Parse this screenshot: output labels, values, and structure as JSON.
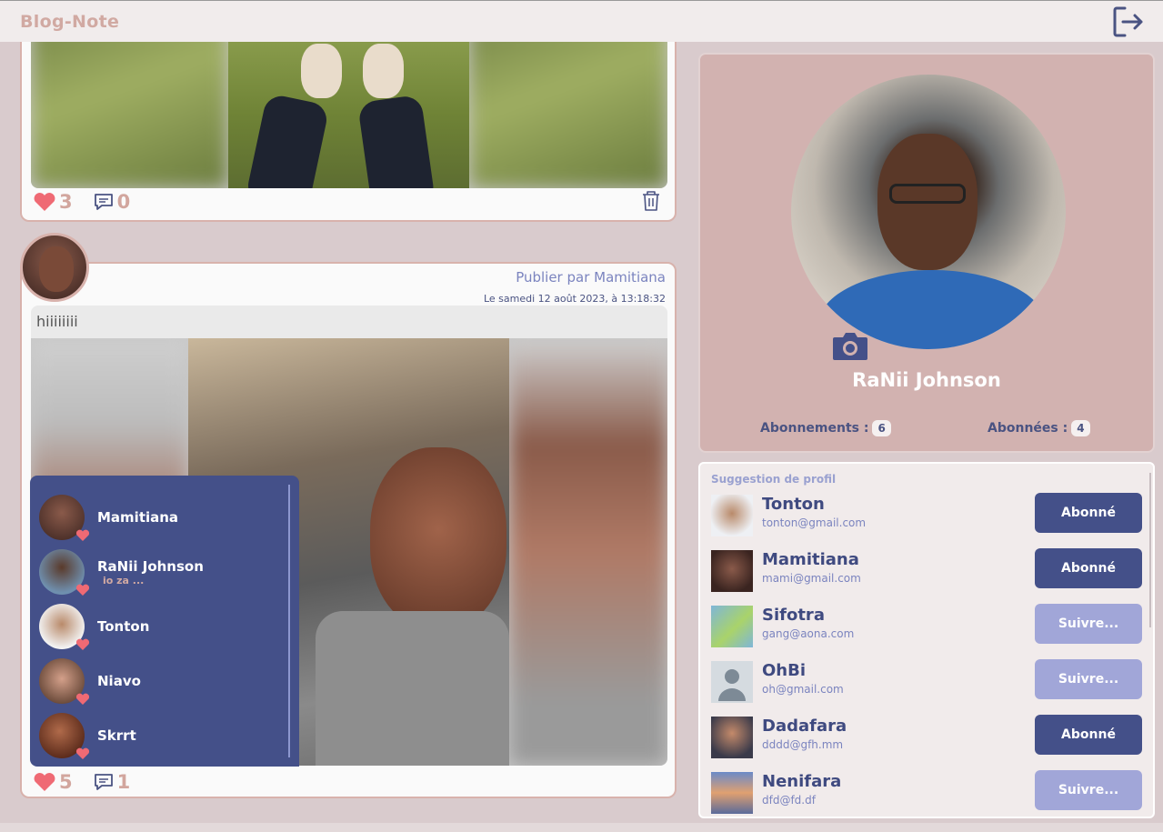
{
  "header": {
    "brand": "Blog-Note"
  },
  "icons": {
    "logout": "logout-icon",
    "heart": "heart-icon",
    "comment": "comment-icon",
    "trash": "trash-icon",
    "camera": "camera-icon"
  },
  "colors": {
    "primary": "#445089",
    "accent": "#d1a9a2",
    "light_button": "#a1a6d8",
    "heart": "#ef6a74"
  },
  "posts": [
    {
      "likes": "3",
      "comments": "0"
    },
    {
      "author": "Publier par Mamitiana",
      "date": "Le samedi 12 août 2023, à 13:18:32",
      "text": "hiiiiiiii",
      "likes": "5",
      "comments": "1"
    }
  ],
  "chat": {
    "items": [
      {
        "name": "Mamitiana",
        "sub": ""
      },
      {
        "name": "RaNii Johnson",
        "sub": "io za ..."
      },
      {
        "name": "Tonton",
        "sub": ""
      },
      {
        "name": "Niavo",
        "sub": ""
      },
      {
        "name": "Skrrt",
        "sub": ""
      }
    ]
  },
  "profile": {
    "name": "RaNii Johnson",
    "following_label": "Abonnements :",
    "following_count": "6",
    "followers_label": "Abonnées :",
    "followers_count": "4"
  },
  "suggestions": {
    "title": "Suggestion de profil",
    "items": [
      {
        "name": "Tonton",
        "email": "tonton@gmail.com",
        "button": "Abonné",
        "state": "subscribed"
      },
      {
        "name": "Mamitiana",
        "email": "mami@gmail.com",
        "button": "Abonné",
        "state": "subscribed"
      },
      {
        "name": "Sifotra",
        "email": "gang@aona.com",
        "button": "Suivre...",
        "state": "follow"
      },
      {
        "name": "OhBi",
        "email": "oh@gmail.com",
        "button": "Suivre...",
        "state": "follow"
      },
      {
        "name": "Dadafara",
        "email": "dddd@gfh.mm",
        "button": "Abonné",
        "state": "subscribed"
      },
      {
        "name": "Nenifara",
        "email": "dfd@fd.df",
        "button": "Suivre...",
        "state": "follow"
      }
    ]
  }
}
